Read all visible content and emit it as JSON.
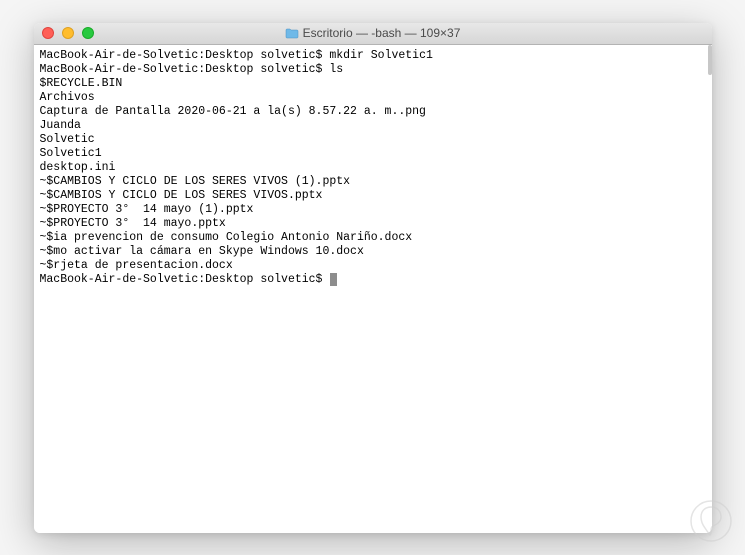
{
  "titlebar": {
    "title": "Escritorio — -bash — 109×37"
  },
  "terminal": {
    "lines": [
      {
        "prompt": "MacBook-Air-de-Solvetic:Desktop solvetic$ ",
        "command": "mkdir Solvetic1"
      },
      {
        "prompt": "MacBook-Air-de-Solvetic:Desktop solvetic$ ",
        "command": "ls"
      },
      {
        "output": "$RECYCLE.BIN"
      },
      {
        "output": "Archivos"
      },
      {
        "output": "Captura de Pantalla 2020-06-21 a la(s) 8.57.22 a. m..png"
      },
      {
        "output": "Juanda"
      },
      {
        "output": "Solvetic"
      },
      {
        "output": "Solvetic1"
      },
      {
        "output": "desktop.ini"
      },
      {
        "output": "~$CAMBIOS Y CICLO DE LOS SERES VIVOS (1).pptx"
      },
      {
        "output": "~$CAMBIOS Y CICLO DE LOS SERES VIVOS.pptx"
      },
      {
        "output": "~$PROYECTO 3°  14 mayo (1).pptx"
      },
      {
        "output": "~$PROYECTO 3°  14 mayo.pptx"
      },
      {
        "output": "~$ia prevencion de consumo Colegio Antonio Nariño.docx"
      },
      {
        "output": "~$mo activar la cámara en Skype Windows 10.docx"
      },
      {
        "output": "~$rjeta de presentacion.docx"
      },
      {
        "prompt": "MacBook-Air-de-Solvetic:Desktop solvetic$ ",
        "command": "",
        "cursor": true
      }
    ]
  }
}
